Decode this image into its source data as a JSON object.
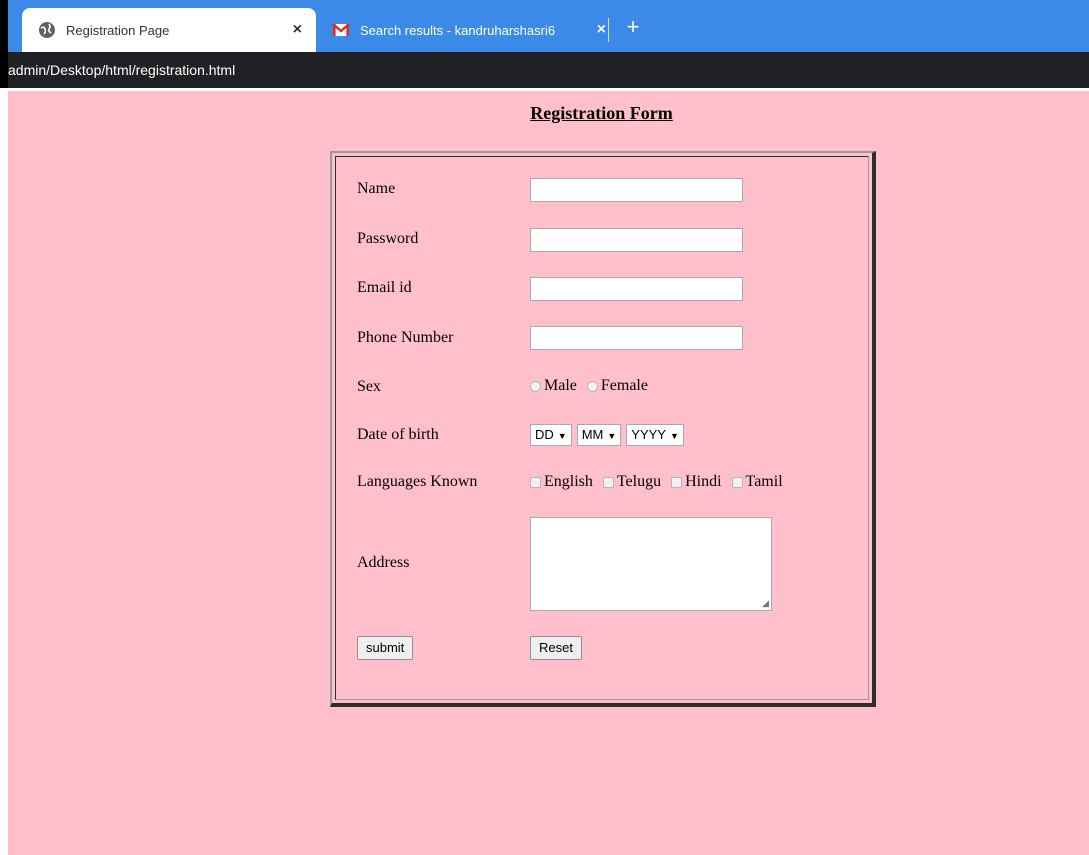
{
  "browser": {
    "tabs": [
      {
        "title": "Registration Page",
        "close": "×",
        "active": true
      },
      {
        "title": "Search results - kandruharshasri6",
        "close": "×",
        "active": false
      }
    ],
    "new_tab": "+",
    "address": "admin/Desktop/html/registration.html"
  },
  "page": {
    "heading": "Registration Form",
    "background": "#ffc0cb",
    "fields": {
      "name_label": "Name",
      "password_label": "Password",
      "email_label": "Email id",
      "phone_label": "Phone Number",
      "sex_label": "Sex",
      "dob_label": "Date of birth",
      "languages_label": "Languages Known",
      "address_label": "Address"
    },
    "sex_options": [
      "Male",
      "Female"
    ],
    "dob": {
      "day": "DD",
      "month": "MM",
      "year": "YYYY"
    },
    "languages": [
      "English",
      "Telugu",
      "Hindi",
      "Tamil"
    ],
    "buttons": {
      "submit": "submit",
      "reset": "Reset"
    }
  },
  "colors": {
    "tab_bar": "#3c8ae8",
    "address_bar": "#202124",
    "gmail_red": "#d93025"
  },
  "icons": {
    "tab1_favicon": "globe-icon",
    "tab2_favicon": "gmail-icon"
  }
}
